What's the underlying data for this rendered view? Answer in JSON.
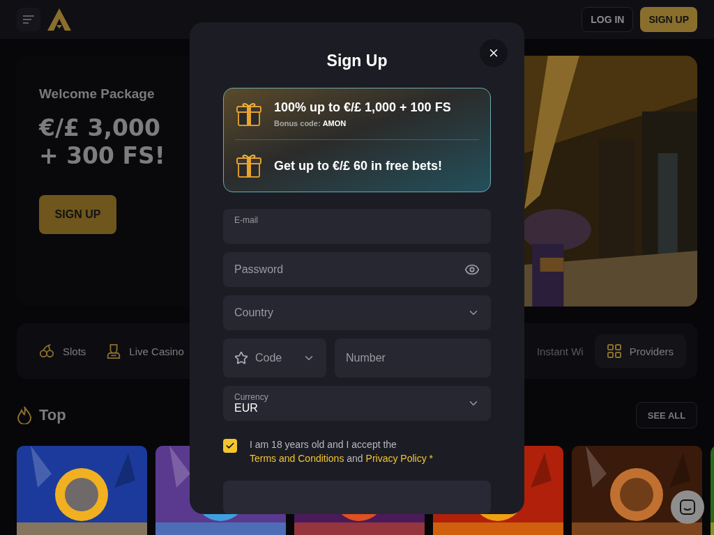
{
  "header": {
    "buttons": [
      {
        "label": "LOG IN",
        "kind": "outline"
      },
      {
        "label": "SIGN UP",
        "kind": "primary"
      }
    ]
  },
  "hero": {
    "subtitle": "Welcome Package",
    "headline": [
      "€/£ 3,000",
      "+ 300 FS!"
    ],
    "button": "SIGN UP"
  },
  "categories": [
    {
      "label": "Slots",
      "kind": "plain"
    },
    {
      "label": "Live Casino",
      "kind": "plain"
    },
    {
      "label": "Instant Wi",
      "kind": "faded"
    },
    {
      "label": "Providers",
      "kind": "boxed"
    }
  ],
  "top": {
    "title": "Top",
    "button": "SEE ALL"
  },
  "modal": {
    "title": "Sign Up",
    "promos": [
      {
        "title": "100% up to €/£ 1,000 + 100 FS",
        "code": "Bonus code: **AMON**"
      },
      {
        "title": "Get up to €/£ 60 in free bets!"
      }
    ],
    "fields": [
      {
        "kind": "text",
        "label": "E-mail"
      },
      {
        "kind": "password",
        "placeholder": "Password"
      },
      {
        "kind": "select",
        "placeholder": "Country"
      },
      {
        "kind": "phone",
        "code_placeholder": "Code",
        "placeholder": "Number"
      },
      {
        "kind": "select",
        "label": "Currency",
        "value": "EUR"
      }
    ],
    "consent": {
      "checked": true,
      "text": "I am 18 years old and I accept the",
      "terms": "Terms and Conditions",
      "and": "and",
      "privacy": "Privacy Policy",
      "mark": "*"
    }
  }
}
